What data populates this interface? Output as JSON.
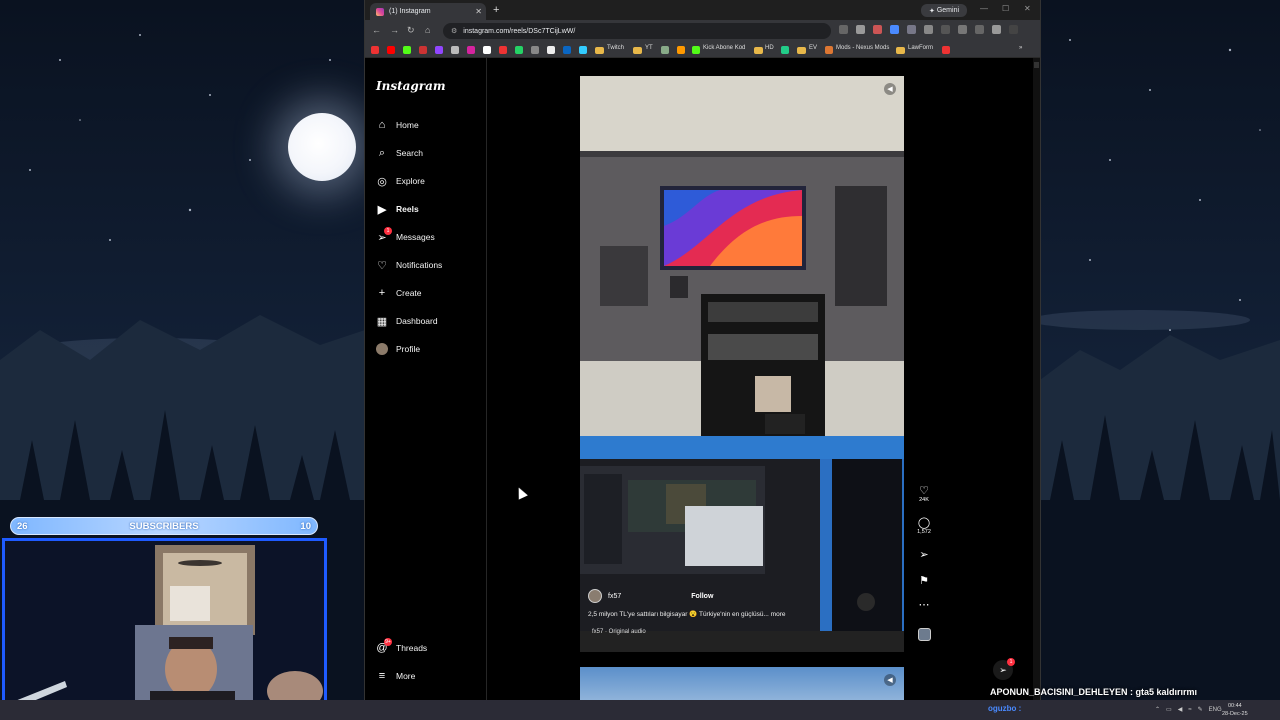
{
  "browser": {
    "tab_title": "(1) Instagram",
    "gemini_label": "Gemini",
    "url": "instagram.com/reels/DSc7TCijLwW/",
    "bookmarks": [
      {
        "label": "Twitch"
      },
      {
        "label": "YT"
      },
      {
        "label": "Kick Abone Kod"
      },
      {
        "label": "HD"
      },
      {
        "label": "EV"
      },
      {
        "label": "Mods - Nexus Mods"
      },
      {
        "label": "LawForm"
      }
    ]
  },
  "instagram": {
    "logo": "Instagram",
    "nav": [
      {
        "label": "Home",
        "icon": "home-icon"
      },
      {
        "label": "Search",
        "icon": "search-icon"
      },
      {
        "label": "Explore",
        "icon": "explore-icon"
      },
      {
        "label": "Reels",
        "icon": "reels-icon"
      },
      {
        "label": "Messages",
        "icon": "messages-icon",
        "badge": "1"
      },
      {
        "label": "Notifications",
        "icon": "heart-icon"
      },
      {
        "label": "Create",
        "icon": "plus-icon"
      },
      {
        "label": "Dashboard",
        "icon": "dashboard-icon"
      },
      {
        "label": "Profile",
        "icon": "avatar"
      }
    ],
    "threads_label": "Threads",
    "threads_badge": "9+",
    "more_label": "More",
    "reel": {
      "username": "fx57",
      "follow_label": "Follow",
      "caption": "2,5 milyon TL'ye sattıları bilgisayar 😮 Türkiye'nin en güçlüsü... more",
      "audio": "fx57 · Original audio",
      "likes": "24K",
      "comments": "1,572"
    },
    "fab_badge": "1"
  },
  "overlay": {
    "subs_left": "26",
    "subs_label": "SUBSCRIBERS",
    "subs_right": "10",
    "chat_line": "APONUN_BACISINI_DEHLEYEN : gta5 kaldırırmı",
    "taskbar_user": "oguzbo :",
    "lang": "ENG",
    "time": "00:44",
    "date": "28-Dec-25"
  },
  "colors": {
    "accent": "#1f5bff",
    "badge": "#ff3040"
  }
}
